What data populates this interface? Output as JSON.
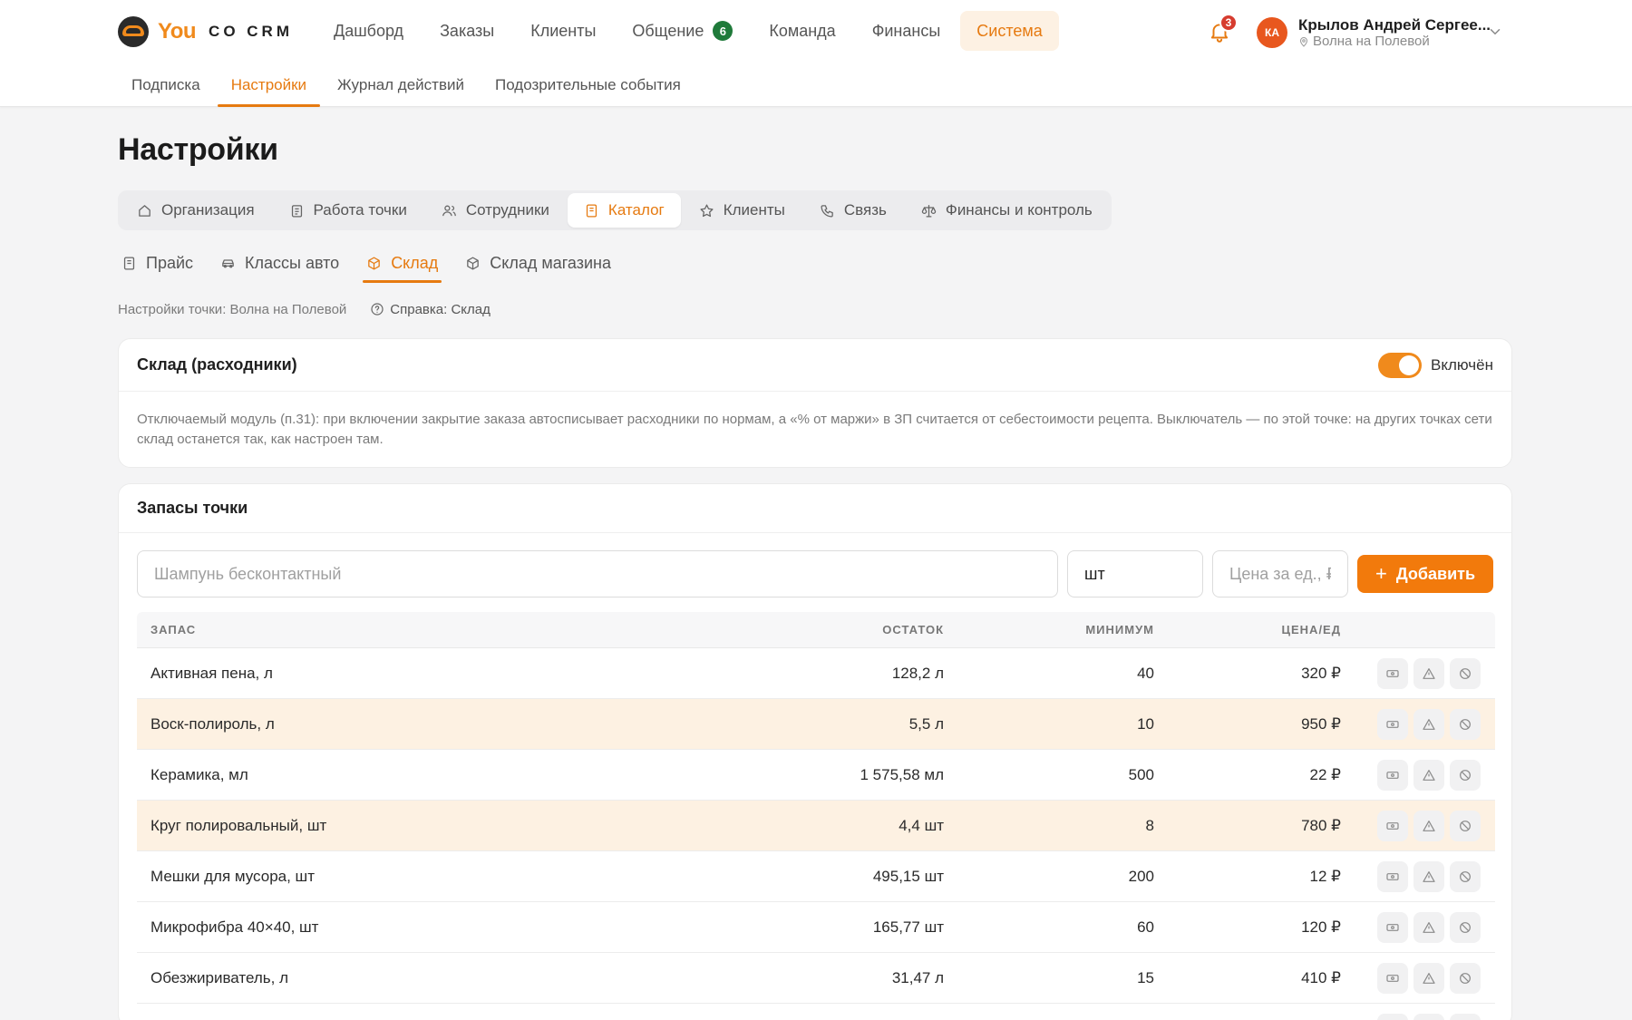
{
  "brand": {
    "you": "You",
    "rest": "CO CRM"
  },
  "main_nav": [
    {
      "label": "Дашборд",
      "active": false
    },
    {
      "label": "Заказы",
      "active": false
    },
    {
      "label": "Клиенты",
      "active": false
    },
    {
      "label": "Общение",
      "active": false,
      "badge": "6"
    },
    {
      "label": "Команда",
      "active": false
    },
    {
      "label": "Финансы",
      "active": false
    },
    {
      "label": "Система",
      "active": true
    }
  ],
  "notifications": {
    "count": "3"
  },
  "user": {
    "initials": "КА",
    "name": "Крылов Андрей Сергее...",
    "location": "Волна на Полевой"
  },
  "sub_nav": [
    {
      "label": "Подписка",
      "active": false
    },
    {
      "label": "Настройки",
      "active": true
    },
    {
      "label": "Журнал действий",
      "active": false
    },
    {
      "label": "Подозрительные события",
      "active": false
    }
  ],
  "page_title": "Настройки",
  "settings_tabs": [
    {
      "label": "Организация",
      "icon": "home-icon",
      "active": false
    },
    {
      "label": "Работа точки",
      "icon": "clipboard-icon",
      "active": false
    },
    {
      "label": "Сотрудники",
      "icon": "users-icon",
      "active": false
    },
    {
      "label": "Каталог",
      "icon": "book-icon",
      "active": true
    },
    {
      "label": "Клиенты",
      "icon": "star-icon",
      "active": false
    },
    {
      "label": "Связь",
      "icon": "phone-icon",
      "active": false
    },
    {
      "label": "Финансы и контроль",
      "icon": "scales-icon",
      "active": false
    }
  ],
  "catalog_tabs": [
    {
      "label": "Прайс",
      "icon": "book-icon",
      "active": false
    },
    {
      "label": "Классы авто",
      "icon": "car-icon",
      "active": false
    },
    {
      "label": "Склад",
      "icon": "box-icon",
      "active": true
    },
    {
      "label": "Склад магазина",
      "icon": "box-icon",
      "active": false
    }
  ],
  "context": {
    "point_settings": "Настройки точки: Волна на Полевой",
    "help": "Справка: Склад"
  },
  "warehouse_module": {
    "title": "Склад (расходники)",
    "toggle_label": "Включён",
    "enabled": true,
    "description": "Отключаемый модуль (п.31): при включении закрытие заказа автосписывает расходники по нормам, а «% от маржи» в ЗП считается от себестоимости рецепта. Выключатель — по этой точке: на других точках сети склад останется так, как настроен там."
  },
  "stock": {
    "title": "Запасы точки",
    "add_form": {
      "name_placeholder": "Шампунь бесконтактный",
      "unit_value": "шт",
      "price_placeholder": "Цена за ед., ₽",
      "add_label": "Добавить"
    },
    "columns": {
      "name": "ЗАПАС",
      "stock": "ОСТАТОК",
      "min": "МИНИМУМ",
      "price": "ЦЕНА/ЕД"
    },
    "rows": [
      {
        "name": "Активная пена, л",
        "stock": "128,2 л",
        "min": "40",
        "price": "320 ₽",
        "warn": false
      },
      {
        "name": "Воск-полироль, л",
        "stock": "5,5 л",
        "min": "10",
        "price": "950 ₽",
        "warn": true
      },
      {
        "name": "Керамика, мл",
        "stock": "1 575,58 мл",
        "min": "500",
        "price": "22 ₽",
        "warn": false
      },
      {
        "name": "Круг полировальный, шт",
        "stock": "4,4 шт",
        "min": "8",
        "price": "780 ₽",
        "warn": true
      },
      {
        "name": "Мешки для мусора, шт",
        "stock": "495,15 шт",
        "min": "200",
        "price": "12 ₽",
        "warn": false
      },
      {
        "name": "Микрофибра 40×40, шт",
        "stock": "165,77 шт",
        "min": "60",
        "price": "120 ₽",
        "warn": false
      },
      {
        "name": "Обезжириватель, л",
        "stock": "31,47 л",
        "min": "15",
        "price": "410 ₽",
        "warn": false
      },
      {
        "name": "",
        "stock": "",
        "min": "",
        "price": "",
        "warn": false
      }
    ]
  },
  "colors": {
    "accent": "#f08a1c",
    "warn_row": "#fdf1e2",
    "badge_green": "#1f7a3a",
    "badge_red": "#d63c2f"
  }
}
